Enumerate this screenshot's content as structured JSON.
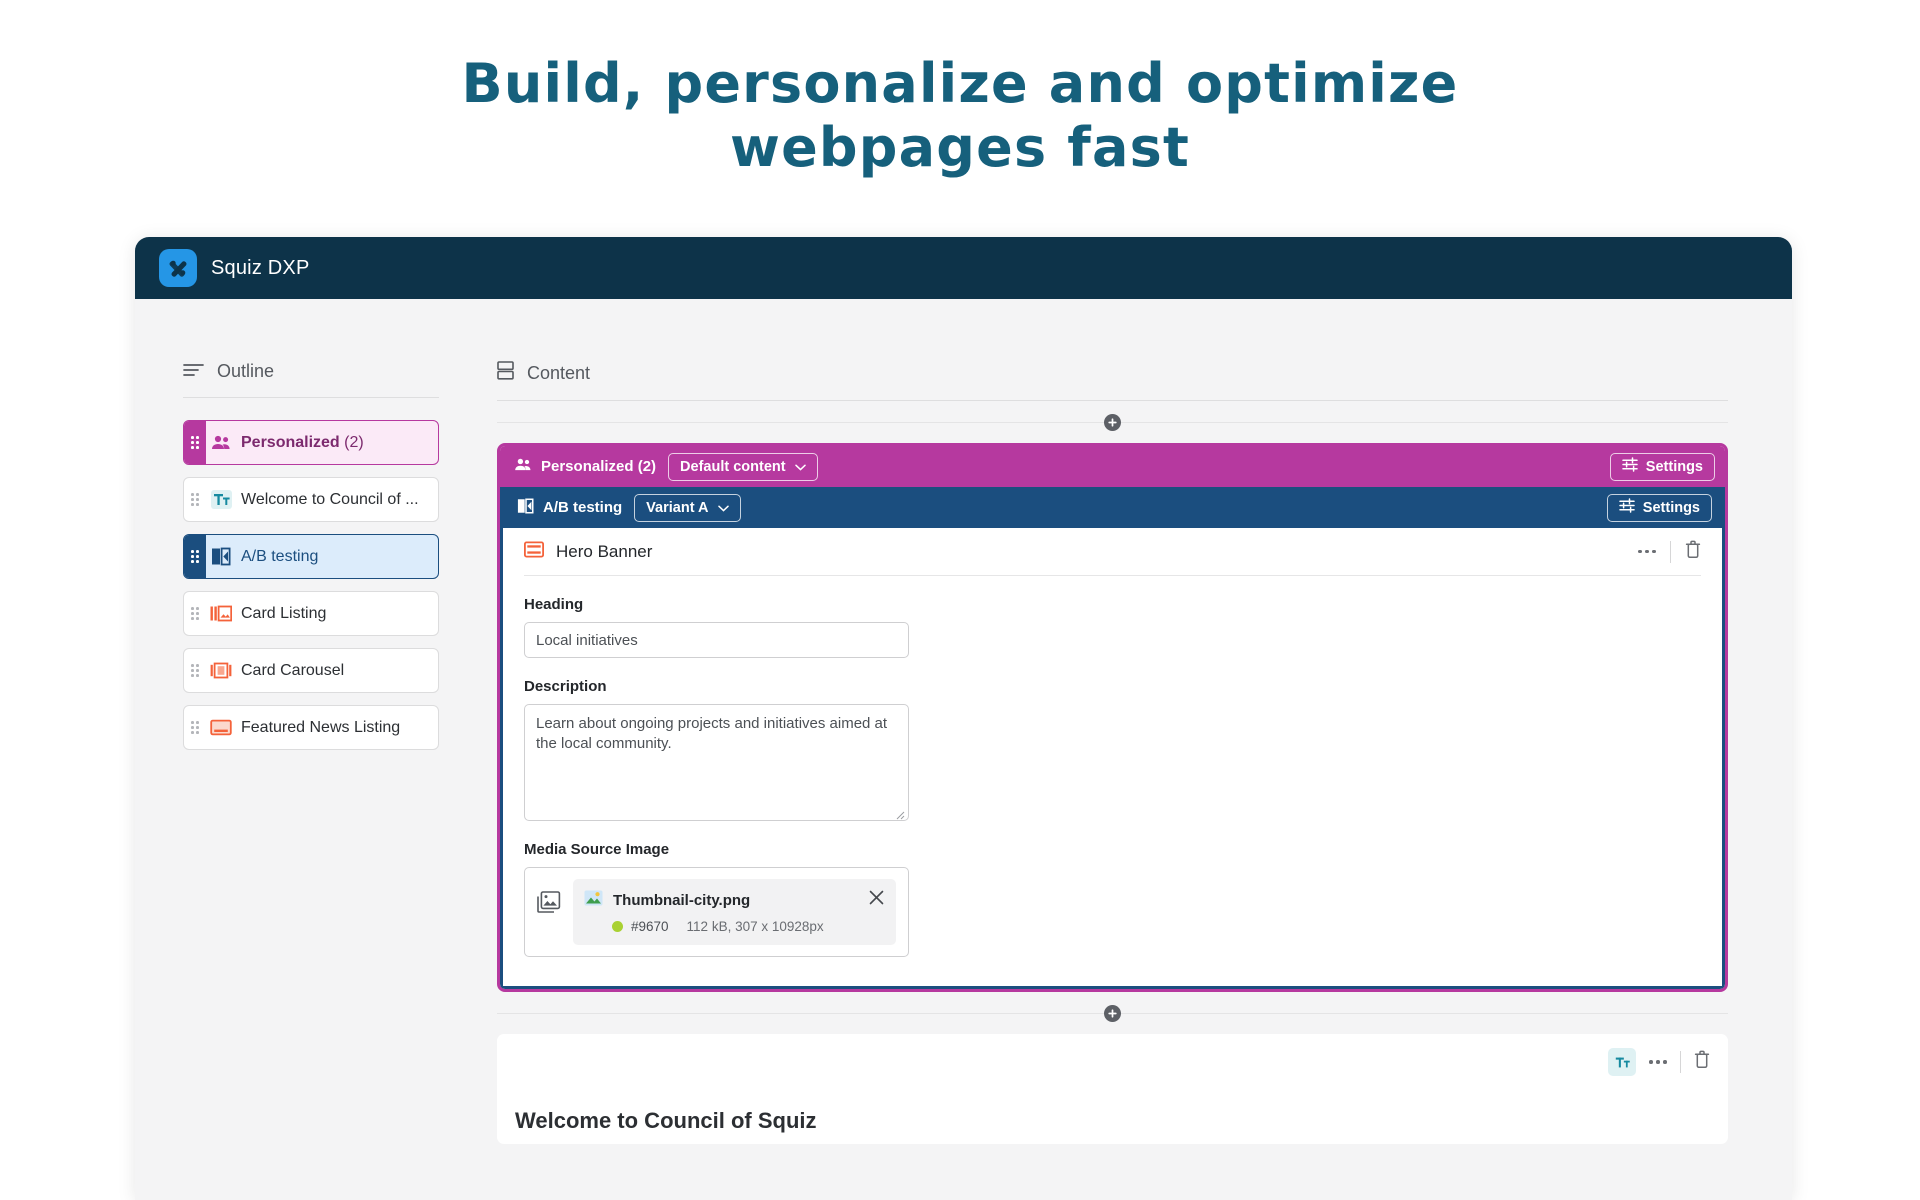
{
  "headline": {
    "line1": "Build, personalize and optimize",
    "line2": "webpages fast",
    "color": "#16607c"
  },
  "app": {
    "title": "Squiz DXP",
    "logo_icon": "squiz-logo-icon",
    "header_color": "#0d3349"
  },
  "outline": {
    "panel_icon": "outline-icon",
    "panel_title": "Outline",
    "items": [
      {
        "label": "Personalized",
        "count": "(2)",
        "icon": "people-icon",
        "state": "personalized"
      },
      {
        "label": "Welcome to Council of ...",
        "icon": "text-tt-icon",
        "state": "default"
      },
      {
        "label": "A/B testing",
        "icon": "ab-split-icon",
        "state": "selected"
      },
      {
        "label": "Card Listing",
        "icon": "card-listing-icon",
        "state": "default"
      },
      {
        "label": "Card Carousel",
        "icon": "card-carousel-icon",
        "state": "default"
      },
      {
        "label": "Featured News Listing",
        "icon": "featured-news-icon",
        "state": "default"
      }
    ]
  },
  "content": {
    "panel_icon": "content-layout-icon",
    "panel_title": "Content",
    "add_button_label": "+",
    "personalized_bar": {
      "icon": "people-icon",
      "title": "Personalized (2)",
      "dropdown_value": "Default content",
      "settings_label": "Settings",
      "settings_icon": "sliders-icon",
      "color": "#b6399f"
    },
    "ab_bar": {
      "icon": "ab-split-icon",
      "title": "A/B testing",
      "dropdown_value": "Variant A",
      "settings_label": "Settings",
      "settings_icon": "sliders-icon",
      "color": "#1b4e7f"
    },
    "component": {
      "icon": "hero-banner-icon",
      "title": "Hero Banner",
      "more_icon": "ellipsis-icon",
      "delete_icon": "trash-icon",
      "fields": {
        "heading_label": "Heading",
        "heading_value": "Local initiatives",
        "description_label": "Description",
        "description_value": "Learn about ongoing projects and initiatives aimed at the local community.",
        "media_label": "Media Source Image",
        "media": {
          "placeholder_icon": "image-stack-icon",
          "thumb_icon": "image-icon",
          "file_name": "Thumbnail-city.png",
          "status_dot_color": "#a9d132",
          "asset_id": "#9670",
          "file_meta": "112 kB, 307 x 10928px",
          "remove_icon": "close-icon"
        }
      }
    },
    "bottom_card": {
      "type_icon": "text-tt-icon",
      "more_icon": "ellipsis-icon",
      "delete_icon": "trash-icon",
      "heading": "Welcome to Council of Squiz"
    }
  }
}
